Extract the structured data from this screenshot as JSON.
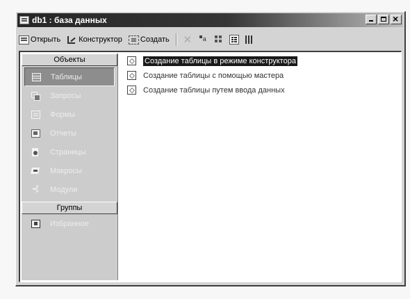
{
  "window": {
    "title": "db1 : база данных"
  },
  "toolbar": {
    "open_label": "Открыть",
    "design_label": "Конструктор",
    "create_label": "Создать",
    "delete_symbol": "✕"
  },
  "sidebar": {
    "objects_header": "Объекты",
    "items": [
      {
        "label": "Таблицы",
        "icon": "table-icon",
        "active": true
      },
      {
        "label": "Запросы",
        "icon": "query-icon"
      },
      {
        "label": "Формы",
        "icon": "form-icon"
      },
      {
        "label": "Отчеты",
        "icon": "report-icon"
      },
      {
        "label": "Страницы",
        "icon": "page-icon"
      },
      {
        "label": "Макросы",
        "icon": "macro-icon"
      },
      {
        "label": "Модули",
        "icon": "module-icon"
      }
    ],
    "groups_header": "Группы",
    "favorites_label": "Избранное"
  },
  "main": {
    "items": [
      {
        "label": "Создание таблицы в режиме конструктора",
        "selected": true
      },
      {
        "label": "Создание таблицы с помощью мастера"
      },
      {
        "label": "Создание таблицы путем ввода данных"
      }
    ]
  }
}
